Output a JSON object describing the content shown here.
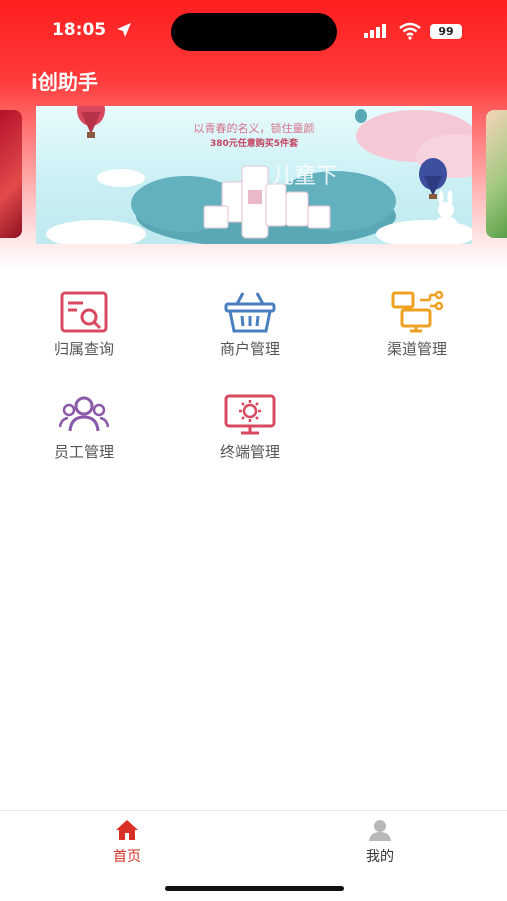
{
  "status_bar": {
    "time": "18:05",
    "battery": "99"
  },
  "app": {
    "title": "i创助手"
  },
  "banner": {
    "slogan": "以青春的名义，锁住童颜",
    "promo": "380元任意购买5件套",
    "brand": "儿童下"
  },
  "menu": {
    "items": [
      {
        "label": "归属查询",
        "icon": "search-document-icon",
        "color": "#d9485f"
      },
      {
        "label": "商户管理",
        "icon": "basket-icon",
        "color": "#4a7fbf"
      },
      {
        "label": "渠道管理",
        "icon": "channel-network-icon",
        "color": "#f0a020"
      },
      {
        "label": "员工管理",
        "icon": "users-icon",
        "color": "#8a5aa8"
      },
      {
        "label": "终端管理",
        "icon": "terminal-settings-icon",
        "color": "#d9485f"
      }
    ]
  },
  "tabbar": {
    "home": {
      "label": "首页",
      "color": "#d93025"
    },
    "mine": {
      "label": "我的",
      "color": "#333333"
    }
  }
}
